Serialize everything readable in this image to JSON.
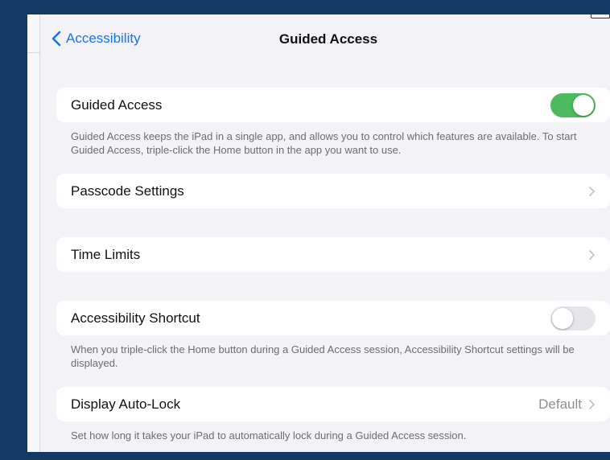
{
  "nav": {
    "back_label": "Accessibility",
    "title": "Guided Access"
  },
  "guided_access": {
    "label": "Guided Access",
    "enabled": true,
    "footnote": "Guided Access keeps the iPad in a single app, and allows you to control which features are available. To start Guided Access, triple-click the Home button in the app you want to use."
  },
  "passcode_settings": {
    "label": "Passcode Settings"
  },
  "time_limits": {
    "label": "Time Limits"
  },
  "accessibility_shortcut": {
    "label": "Accessibility Shortcut",
    "enabled": false,
    "footnote": "When you triple-click the Home button during a Guided Access session, Accessibility Shortcut settings will be displayed."
  },
  "display_auto_lock": {
    "label": "Display Auto-Lock",
    "value": "Default",
    "footnote": "Set how long it takes your iPad to automatically lock during a Guided Access session."
  },
  "colors": {
    "accent": "#1a73e8",
    "toggle_on": "#4cbb5f",
    "toggle_off": "#e5e5ea",
    "background": "#f2f2f7"
  }
}
